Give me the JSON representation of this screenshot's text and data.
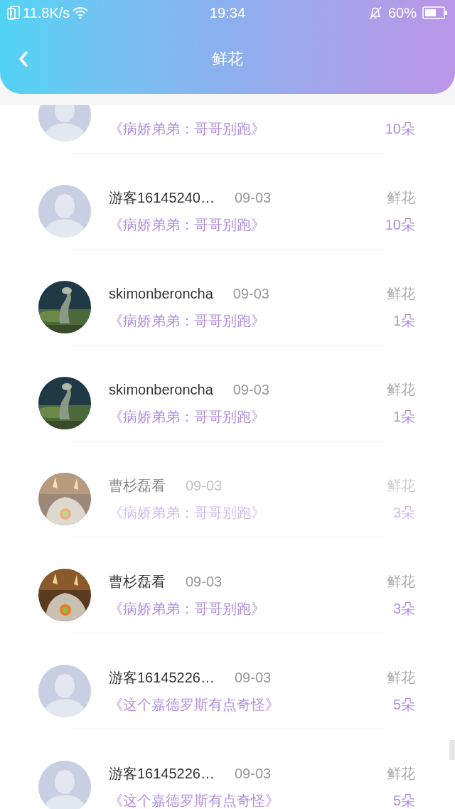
{
  "status_bar": {
    "speed": "11.8K/s",
    "time": "19:34",
    "battery": "60%"
  },
  "header": {
    "title": "鲜花"
  },
  "rows": [
    {
      "avatar": {
        "kind": "default"
      },
      "faded": false,
      "book": "《病娇弟弟：哥哥别跑》",
      "count": "10朵"
    },
    {
      "avatar": {
        "kind": "default"
      },
      "faded": false,
      "name": "游客16145240…",
      "date": "09-03",
      "label": "鲜花",
      "book": "《病娇弟弟：哥哥别跑》",
      "count": "10朵"
    },
    {
      "faded": false,
      "name": "skimonberoncha",
      "date": "09-03",
      "label": "鲜花",
      "book": "《病娇弟弟：哥哥别跑》",
      "count": "1朵"
    },
    {
      "faded": false,
      "name": "skimonberoncha",
      "date": "09-03",
      "label": "鲜花",
      "book": "《病娇弟弟：哥哥别跑》",
      "count": "1朵"
    },
    {
      "faded": true,
      "name": "曹杉磊看",
      "date": "09-03",
      "label": "鲜花",
      "book": "《病娇弟弟：哥哥别跑》",
      "count": "3朵"
    },
    {
      "faded": false,
      "name": "曹杉磊看",
      "date": "09-03",
      "label": "鲜花",
      "book": "《病娇弟弟：哥哥别跑》",
      "count": "3朵"
    },
    {
      "avatar": {
        "kind": "default"
      },
      "faded": false,
      "name": "游客16145226…",
      "date": "09-03",
      "label": "鲜花",
      "book": "《这个嘉德罗斯有点奇怪》",
      "count": "5朵"
    },
    {
      "avatar": {
        "kind": "default"
      },
      "faded": false,
      "name": "游客16145226…",
      "date": "09-03",
      "label": "鲜花",
      "book": "《这个嘉德罗斯有点奇怪》",
      "count": "5朵"
    }
  ]
}
